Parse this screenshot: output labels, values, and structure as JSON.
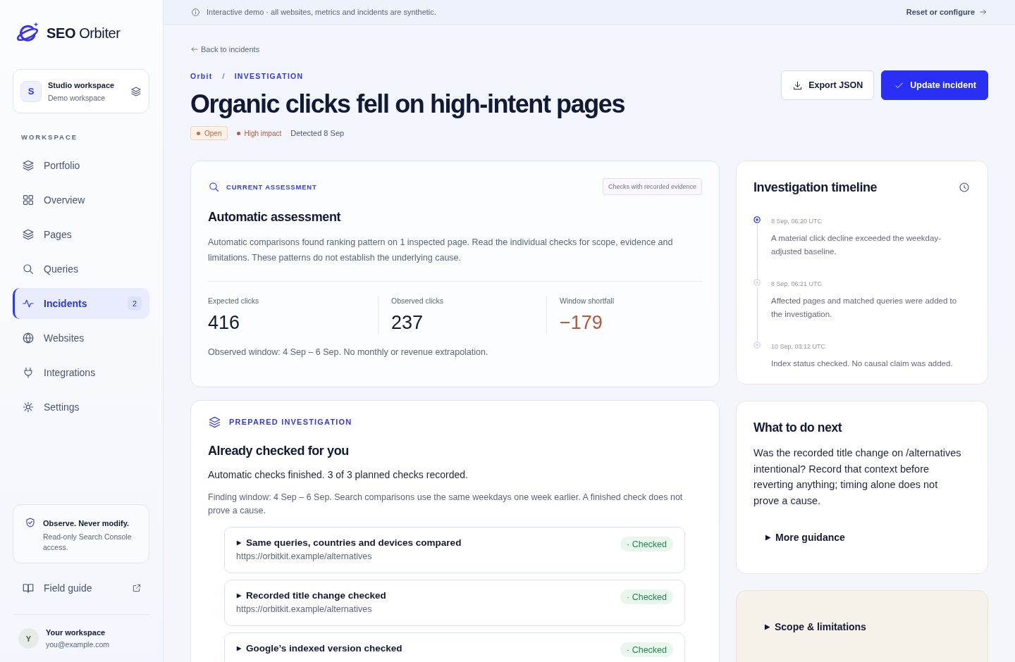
{
  "sidebar": {
    "logo": "**SEO** Orbiter",
    "workspace": {
      "initial": "S",
      "name": "Studio workspace",
      "subtitle": "Demo workspace"
    },
    "section_label": "WORKSPACE",
    "items": [
      {
        "label": "Portfolio",
        "selected": false
      },
      {
        "label": "Overview",
        "selected": false
      },
      {
        "label": "Pages",
        "selected": false
      },
      {
        "label": "Queries",
        "selected": false
      },
      {
        "label": "Incidents",
        "selected": true,
        "badge": "2"
      },
      {
        "label": "Websites",
        "selected": false
      },
      {
        "label": "Integrations",
        "selected": false
      },
      {
        "label": "Settings",
        "selected": false
      }
    ],
    "notice": {
      "title": "Observe. Never modify.",
      "text": "Read-only Search Console access."
    },
    "field_guide": "Field guide",
    "user": {
      "initial": "Y",
      "name": "Your workspace",
      "email": "you@example.com"
    }
  },
  "banner": {
    "text": "Interactive demo · all websites, metrics and incidents are synthetic.",
    "action": "Reset or configure"
  },
  "header": {
    "back": "Back to incidents",
    "breadcrumb": {
      "items": [
        "Orbit",
        "INVESTIGATION"
      ],
      "separator": "/"
    },
    "title": "Organic clicks fell on high-intent pages",
    "tags": [
      {
        "kind": "status",
        "label": "Open"
      },
      {
        "kind": "impact",
        "label": "High impact"
      },
      {
        "kind": "date",
        "label": "Detected 8 Sep"
      }
    ],
    "buttons": [
      {
        "kind": "secondary",
        "label": "Export JSON"
      },
      {
        "kind": "primary",
        "label": "Update incident"
      }
    ]
  },
  "assessment": {
    "eyebrow": "CURRENT ASSESSMENT",
    "tag": "Checks with recorded evidence",
    "title": "Automatic assessment",
    "text": "Automatic comparisons found ranking pattern on 1 inspected page. Read the individual checks for scope, evidence and limitations. These patterns do not establish the underlying cause.",
    "metrics": [
      {
        "label": "Expected clicks",
        "value": "416",
        "negative": false
      },
      {
        "label": "Observed clicks",
        "value": "237",
        "negative": false
      },
      {
        "label": "Window shortfall",
        "value": "−179",
        "negative": true
      }
    ],
    "note": "Observed window: 4 Sep – 6 Sep. No monthly or revenue extrapolation."
  },
  "investigation": {
    "eyebrow": "PREPARED INVESTIGATION",
    "title": "Already checked for you",
    "summary": "Automatic checks finished. 3 of 3 planned checks recorded.",
    "note": "Finding window: 4 Sep – 6 Sep. Search comparisons use the same weekdays one week earlier. A finished check does not prove a cause.",
    "checks": [
      {
        "title": "Same queries, countries and devices compared",
        "url": "https://orbitkit.example/alternatives",
        "status": "· Checked",
        "expanded": false
      },
      {
        "title": "Recorded title change checked",
        "url": "https://orbitkit.example/alternatives",
        "status": "· Checked",
        "expanded": false
      },
      {
        "title": "Google’s indexed version checked",
        "status": "· Checked",
        "expanded": false
      }
    ]
  },
  "timeline": {
    "title": "Investigation timeline",
    "events": [
      {
        "time": "8 Sep, 06:20 UTC",
        "text": "A material click decline exceeded the weekday-adjusted baseline.",
        "current": true
      },
      {
        "time": "8 Sep, 06:21 UTC",
        "text": "Affected pages and matched queries were added to the investigation.",
        "current": false
      },
      {
        "time": "10 Sep, 03:12 UTC",
        "text": "Index status checked. No causal claim was added.",
        "current": false
      }
    ]
  },
  "next_steps": {
    "title": "What to do next",
    "text": "Was the recorded title change on /alternatives intentional? Record that context before reverting anything; timing alone does not prove a cause.",
    "more": {
      "label": "More guidance",
      "expanded": false
    }
  },
  "scope": {
    "label": "Scope & limitations",
    "expanded": false
  }
}
